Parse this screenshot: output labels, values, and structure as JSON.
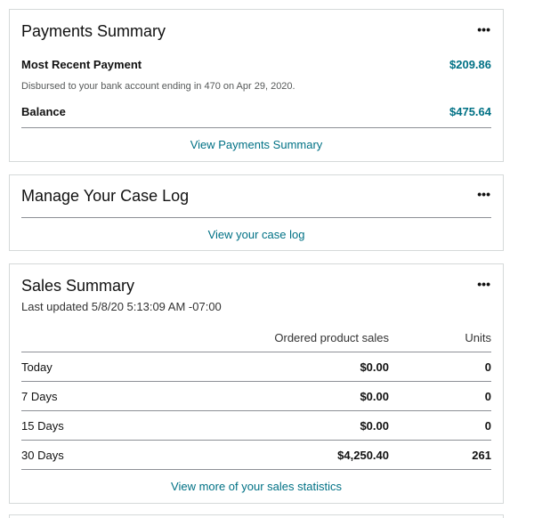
{
  "payments": {
    "title": "Payments Summary",
    "menu": "•••",
    "recent_label": "Most Recent Payment",
    "recent_value": "$209.86",
    "disbursed_note": "Disbursed to your bank account ending in 470 on Apr 29, 2020.",
    "balance_label": "Balance",
    "balance_value": "$475.64",
    "link": "View Payments Summary"
  },
  "caselog": {
    "title": "Manage Your Case Log",
    "menu": "•••",
    "link": "View your case log"
  },
  "sales": {
    "title": "Sales Summary",
    "menu": "•••",
    "updated": "Last updated 5/8/20 5:13:09 AM -07:00",
    "headers": {
      "sales": "Ordered product sales",
      "units": "Units"
    },
    "rows": [
      {
        "period": "Today",
        "sales": "$0.00",
        "units": "0"
      },
      {
        "period": "7 Days",
        "sales": "$0.00",
        "units": "0"
      },
      {
        "period": "15 Days",
        "sales": "$0.00",
        "units": "0"
      },
      {
        "period": "30 Days",
        "sales": "$4,250.40",
        "units": "261"
      }
    ],
    "link": "View more of your sales statistics"
  }
}
